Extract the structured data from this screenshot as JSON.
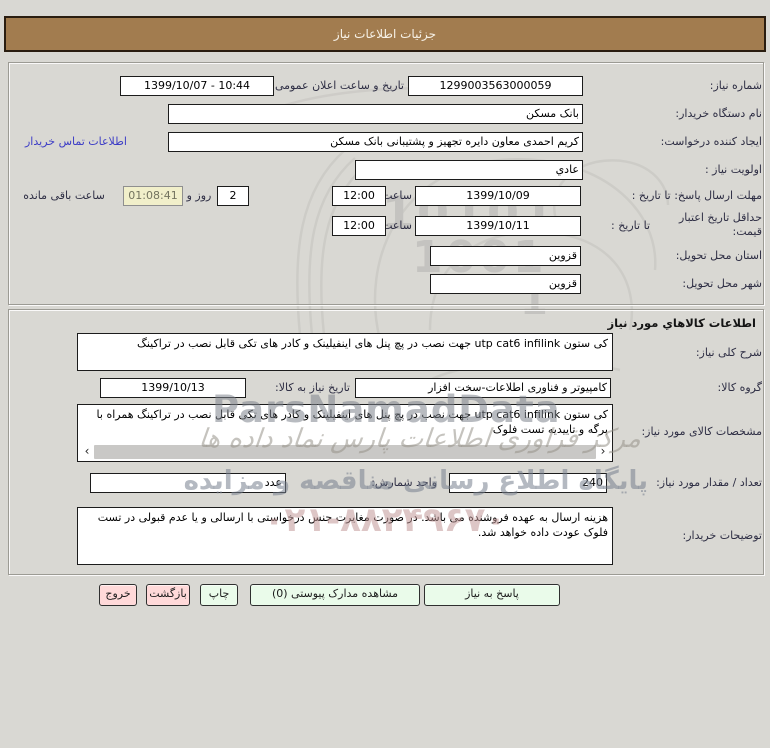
{
  "header": {
    "title": "جزئیات اطلاعات نیاز"
  },
  "form": {
    "need_number": {
      "label": "شماره نیاز:",
      "value": "1299003563000059"
    },
    "announce": {
      "label": "تاریخ و ساعت اعلان عمومی:",
      "value": "1399/10/07 - 10:44"
    },
    "buyer_org": {
      "label": "نام دستگاه خریدار:",
      "value": "بانک مسکن"
    },
    "creator": {
      "label": "ایجاد کننده درخواست:",
      "value": "کریم احمدی معاون دایره تجهیز و پشتیبانی بانک مسکن",
      "contact_link": "اطلاعات تماس خریدار"
    },
    "priority": {
      "label": "اولویت نیاز :",
      "value": "عادي"
    },
    "deadline": {
      "label": "مهلت ارسال پاسخ: تا تاریخ :",
      "date": "1399/10/09",
      "hour_label": "ساعت",
      "time": "12:00",
      "days": "2",
      "days_label": "روز و",
      "countdown": "01:08:41",
      "remaining_label": "ساعت باقی مانده"
    },
    "price_validity": {
      "label": "حداقل تاریخ اعتبار قیمت:",
      "until_label": "تا تاریخ :",
      "date": "1399/10/11",
      "hour_label": "ساعت",
      "time": "12:00"
    },
    "province": {
      "label": "استان محل تحویل:",
      "value": "قزوین"
    },
    "city": {
      "label": "شهر محل تحویل:",
      "value": "قزوین"
    }
  },
  "goods": {
    "section_title": "اطلاعات کالاهاي مورد نیاز",
    "general_desc": {
      "label": "شرح کلی نیاز:",
      "value": "کی ستون utp cat6 infilink جهت نصب در پچ پنل های اینفیلینک و کادر های تکی قابل نصب در تراکینگ"
    },
    "group": {
      "label": "گروه کالا:",
      "value": "کامپیوتر و فناوری اطلاعات-سخت افزار"
    },
    "need_date": {
      "label": "تاریخ نیاز به کالا:",
      "value": "1399/10/13"
    },
    "specs": {
      "label": "مشخصات کالای مورد نیاز:",
      "value": "کی ستون utp cat6 infilink جهت نصب در پچ پنل های اینفیلینک و کادر های تکی قابل نصب در تراکینگ همراه با برگه و تاییدیه تست فلوک",
      "scroll_left_icon": "‹",
      "scroll_right_icon": "›"
    },
    "quantity": {
      "label": "تعداد / مقدار مورد نیاز:",
      "value": "240"
    },
    "unit": {
      "label": "واحد شمارش:",
      "value": "عدد"
    },
    "buyer_notes": {
      "label": "توضیحات خریدار:",
      "value": "هزینه ارسال به عهده فروشنده می باشد. در صورت مغایرت جنس درخواستی با ارسالی و یا عدم قبولی در تست فلوک عودت داده خواهد شد."
    }
  },
  "buttons": {
    "respond": "پاسخ به نیاز",
    "view_attachments": "مشاهده مدارک پیوستی (0)",
    "print": "چاپ",
    "back": "بازگشت",
    "exit": "خروج"
  },
  "watermark": {
    "digits_line1": "10101",
    "digits_line2": "1001",
    "digits_line3": "1",
    "brand": "ParsNamadData",
    "line1": "مرکز فراوری اطلاعات پارس نماد داده ها",
    "line2": "پایگاه اطلاع رسانی مناقصه و مزایده",
    "phone": "۰۲۱-۸۸۲۴۹۶۷۰"
  },
  "colors": {
    "titlebar": "#a27c4f",
    "page_bg": "#d9d8d3",
    "button_pink": "#ffd9d9",
    "button_green": "#eafbea",
    "countdown_bg": "#f1efca",
    "link": "#3d3dc6"
  }
}
